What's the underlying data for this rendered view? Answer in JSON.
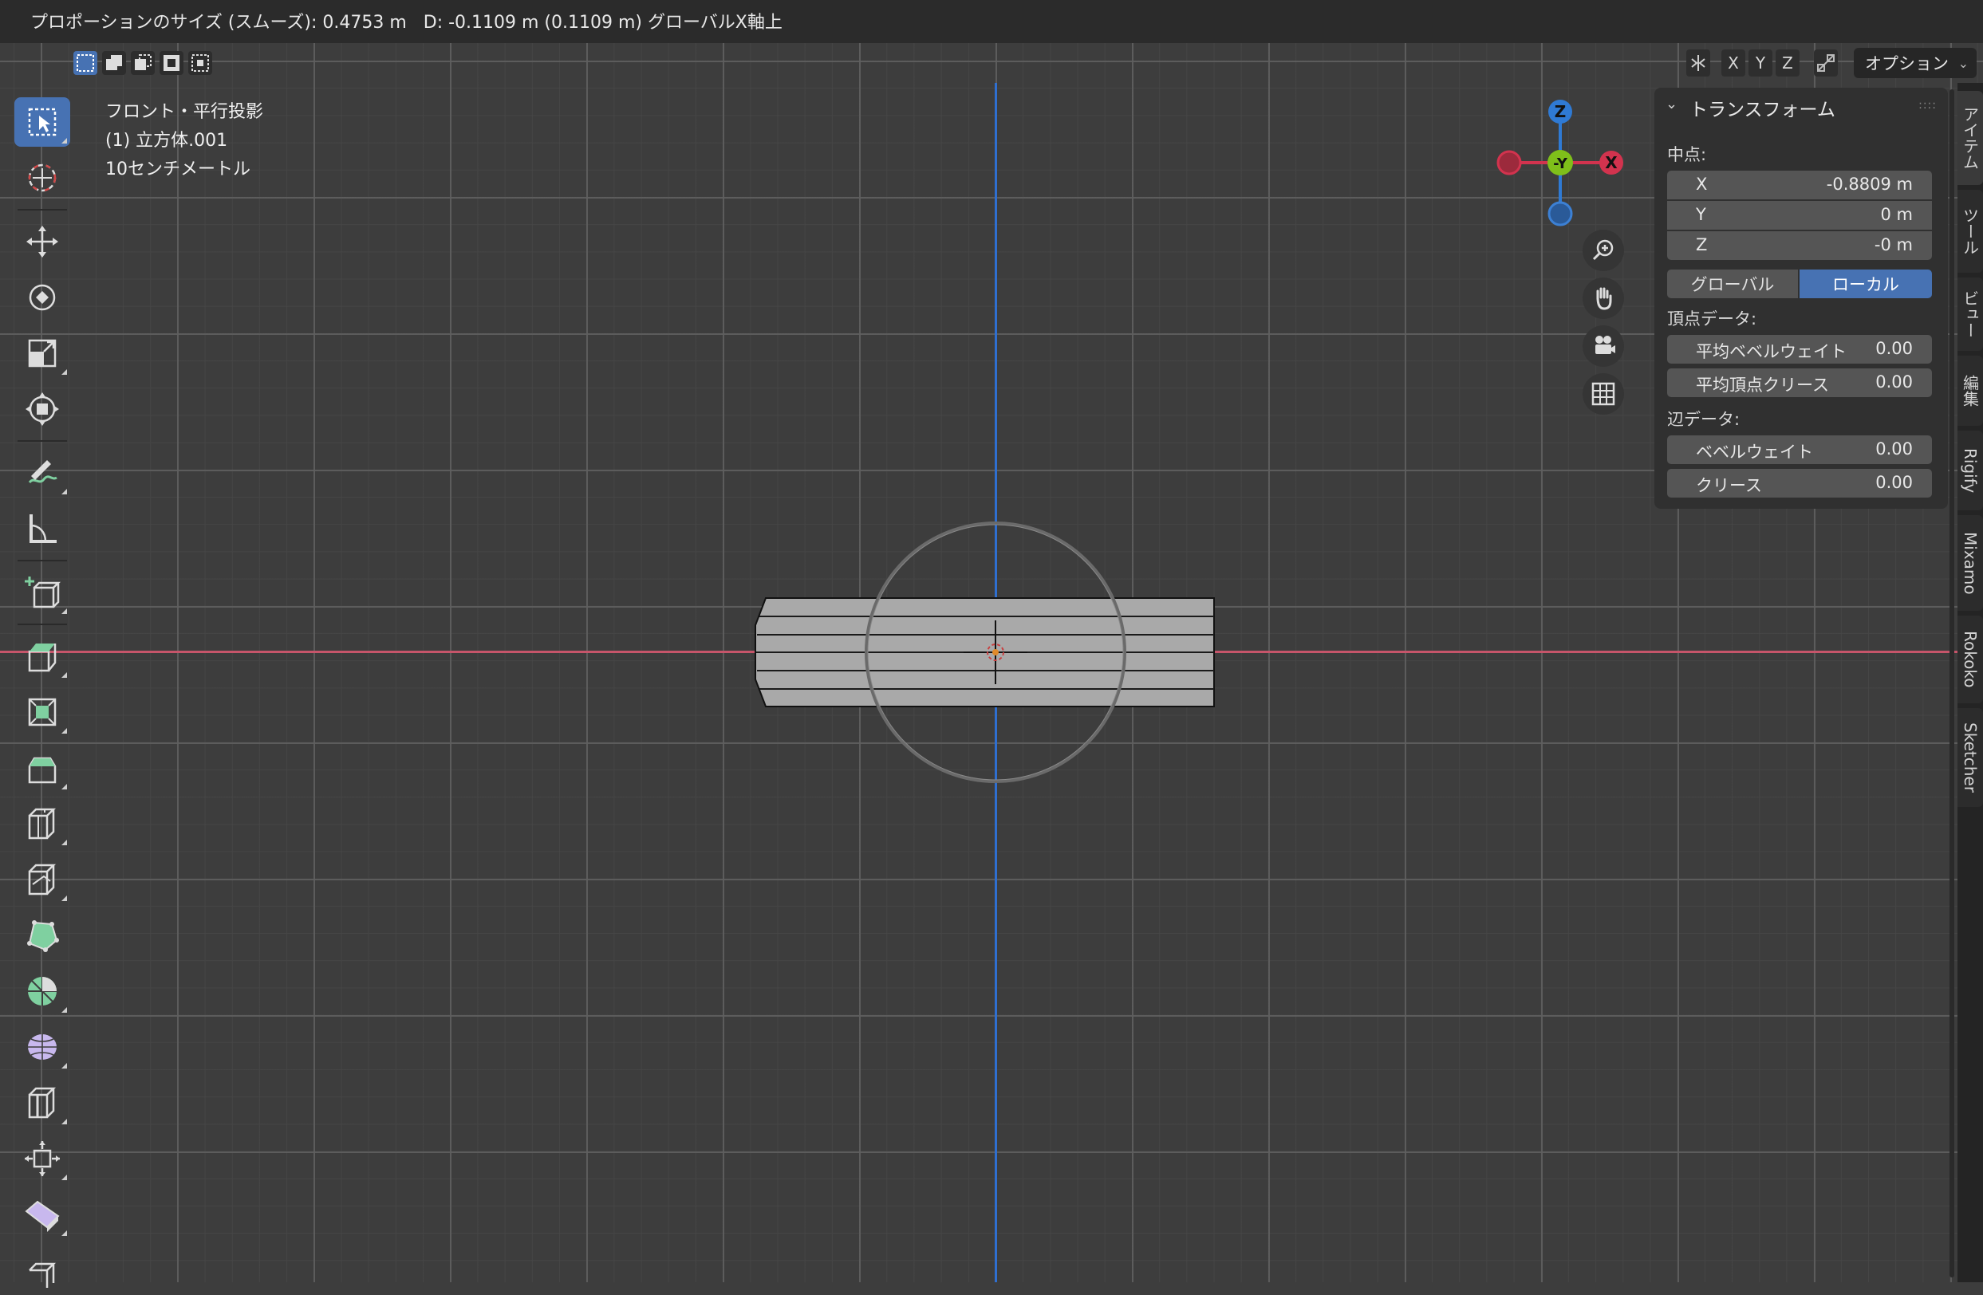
{
  "header": {
    "status_text": "プロポーションのサイズ (スムーズ): 0.4753 m   D: -0.1109 m (0.1109 m) グローバルX軸上"
  },
  "viewport_header": {
    "axis_buttons": [
      "X",
      "Y",
      "Z"
    ],
    "options_label": "オプション"
  },
  "viewport_info": {
    "view_name": "フロント・平行投影",
    "object_name": "(1) 立方体.001",
    "grid_scale": "10センチメートル"
  },
  "gizmo": {
    "z_label": "Z",
    "neg_y_label": "-Y",
    "x_label": "X",
    "colors": {
      "x": "#d2334e",
      "y": "#7fbf1a",
      "z": "#2f7ad4"
    }
  },
  "toolbar": {
    "tools": [
      "select-box",
      "cursor",
      "move",
      "rotate",
      "scale",
      "transform",
      "annotate",
      "measure",
      "add-cube",
      "extrude",
      "inset",
      "bevel",
      "loop-cut",
      "knife",
      "poly-build",
      "spin",
      "smooth",
      "edge-slide",
      "shrink-fatten",
      "shear",
      "rip"
    ]
  },
  "npanel": {
    "title": "トランスフォーム",
    "median_label": "中点:",
    "median": [
      {
        "axis": "X",
        "value": "-0.8809 m"
      },
      {
        "axis": "Y",
        "value": "0 m"
      },
      {
        "axis": "Z",
        "value": "-0 m"
      }
    ],
    "global_label": "グローバル",
    "local_label": "ローカル",
    "vertex_data_label": "頂点データ:",
    "vertex_bevel_weight_label": "平均ベベルウェイト",
    "vertex_bevel_weight_value": "0.00",
    "vertex_crease_label": "平均頂点クリース",
    "vertex_crease_value": "0.00",
    "edge_data_label": "辺データ:",
    "edge_bevel_weight_label": "ベベルウェイト",
    "edge_bevel_weight_value": "0.00",
    "edge_crease_label": "クリース",
    "edge_crease_value": "0.00"
  },
  "side_tabs": [
    "アイテム",
    "ツール",
    "ビュー",
    "編集",
    "Rigify",
    "Mixamo",
    "Rokoko",
    "Sketcher"
  ],
  "accent_color": "#4772b3"
}
